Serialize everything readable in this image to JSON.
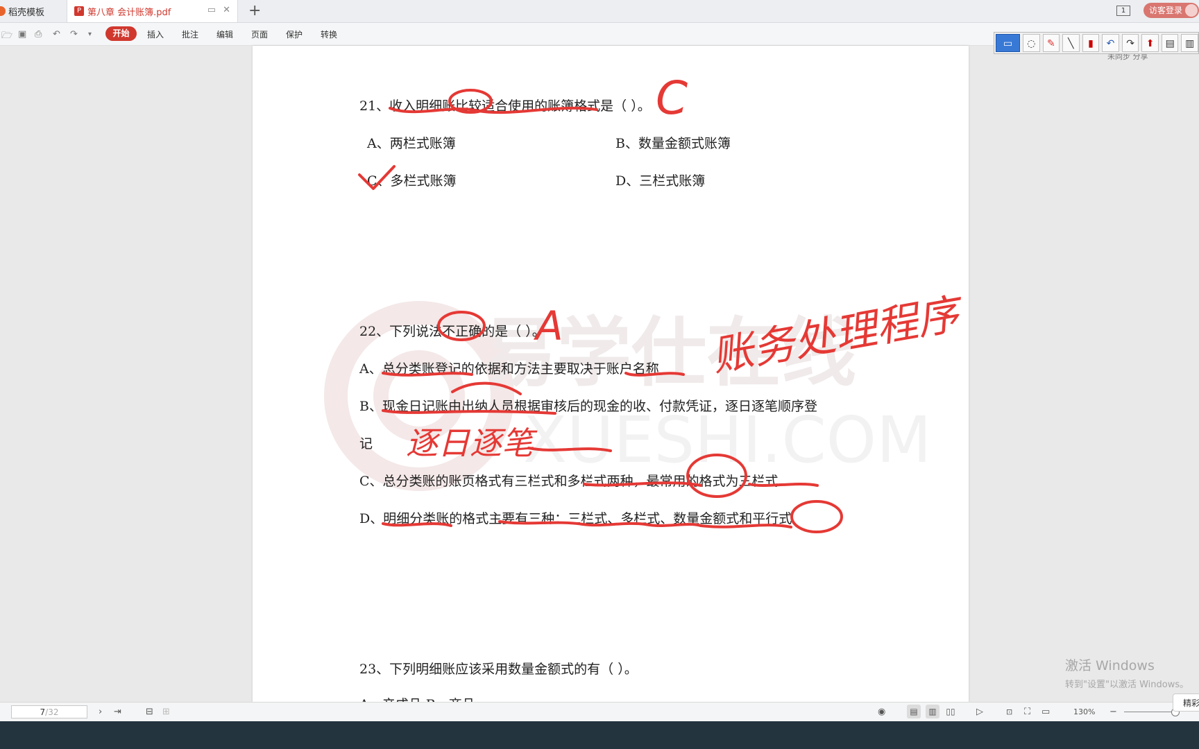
{
  "tabs": {
    "home_label": "稻壳模板",
    "doc_label": "第八章 会计账簿.pdf",
    "doc_icon": "P",
    "new_tab": "+"
  },
  "header": {
    "window_count": "1",
    "login_label": "访客登录"
  },
  "toolbar": {
    "menus": [
      "开始",
      "插入",
      "批注",
      "编辑",
      "页面",
      "保护",
      "转换"
    ],
    "right_hint": "未同步  分享"
  },
  "document": {
    "q21": {
      "stem": "21、收入明细账比较适合使用的账簿格式是（        ）。",
      "A": "A、两栏式账簿",
      "B": "B、数量金额式账簿",
      "C": "C、多栏式账簿",
      "D": "D、三栏式账簿"
    },
    "q22": {
      "stem": "22、下列说法不正确的是（        ）。",
      "A": "A、总分类账登记的依据和方法主要取决于账户名称",
      "B": "B、现金日记账由出纳人员根据审核后的现金的收、付款凭证，逐日逐笔顺序登",
      "B_cont": "记",
      "C": "C、总分类账的账页格式有三栏式和多栏式两种，最常用的格式为三栏式",
      "D": "D、明细分类账的格式主要有三种：三栏式、多栏式、数量金额式和平行式"
    },
    "q23": {
      "stem": "23、下列明细账应该采用数量金额式的有（          ）。",
      "partial": "A、产成品    B、商品"
    },
    "watermark": {
      "cn": "易学仕在线",
      "en": "XUESHI.COM"
    },
    "handwriting": {
      "q21_answer": "C",
      "q22_answer": "A",
      "note_right": "账务处理程序",
      "note_left": "逐日逐笔"
    }
  },
  "status": {
    "page_current": "7",
    "page_total": "/32",
    "zoom": "130%"
  },
  "side_button": "精彩",
  "activation": {
    "line1": "激活 Windows",
    "line2": "转到\"设置\"以激活 Windows。"
  },
  "colors": {
    "accent": "#d0382e",
    "ink": "#e53935",
    "taskbar": "#23343f"
  }
}
